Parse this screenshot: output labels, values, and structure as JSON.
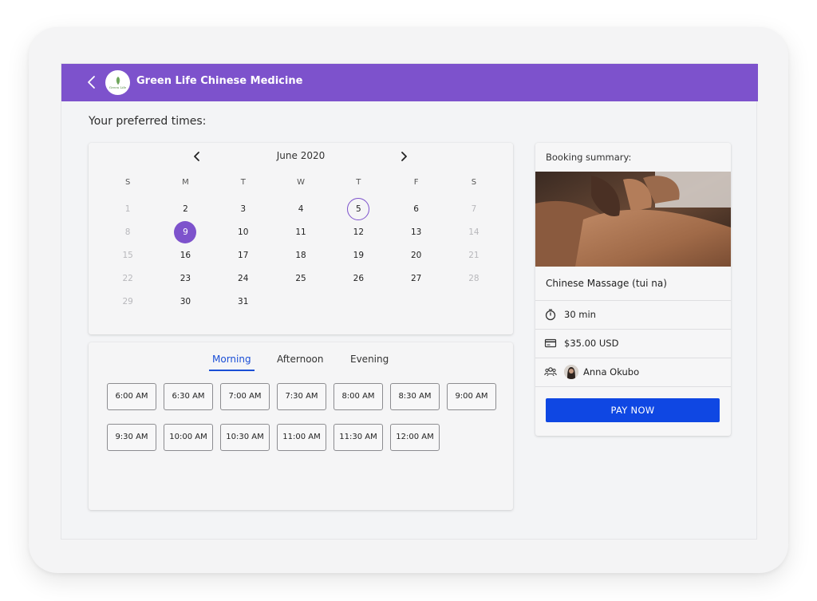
{
  "header": {
    "brand": "Green Life Chinese Medicine",
    "logo_text": "Green Life"
  },
  "page": {
    "section_title": "Your preferred times:"
  },
  "calendar": {
    "month": "June 2020",
    "weekdays": [
      "S",
      "M",
      "T",
      "W",
      "T",
      "F",
      "S"
    ],
    "weeks": [
      [
        "1",
        "2",
        "3",
        "4",
        "5",
        "6",
        "7"
      ],
      [
        "8",
        "9",
        "10",
        "11",
        "12",
        "13",
        "14"
      ],
      [
        "15",
        "16",
        "17",
        "18",
        "19",
        "20",
        "21"
      ],
      [
        "22",
        "23",
        "24",
        "25",
        "26",
        "27",
        "28"
      ],
      [
        "29",
        "30",
        "31",
        "",
        "",
        "",
        ""
      ]
    ],
    "selected_day": "9",
    "today_day": "5"
  },
  "time_tabs": [
    "Morning",
    "Afternoon",
    "Evening"
  ],
  "active_tab": "Morning",
  "slots": [
    "6:00 AM",
    "6:30 AM",
    "7:00 AM",
    "7:30 AM",
    "8:00 AM",
    "8:30 AM",
    "9:00 AM",
    "9:30 AM",
    "10:00 AM",
    "10:30 AM",
    "11:00 AM",
    "11:30 AM",
    "12:00 AM"
  ],
  "summary": {
    "title": "Booking summary:",
    "service": "Chinese Massage (tui na)",
    "duration": "30 min",
    "price": "$35.00 USD",
    "staff": "Anna Okubo",
    "pay_label": "PAY NOW"
  },
  "colors": {
    "accent": "#7d52cc",
    "primary_button": "#0f47e3",
    "active_tab": "#1a4ed6"
  }
}
